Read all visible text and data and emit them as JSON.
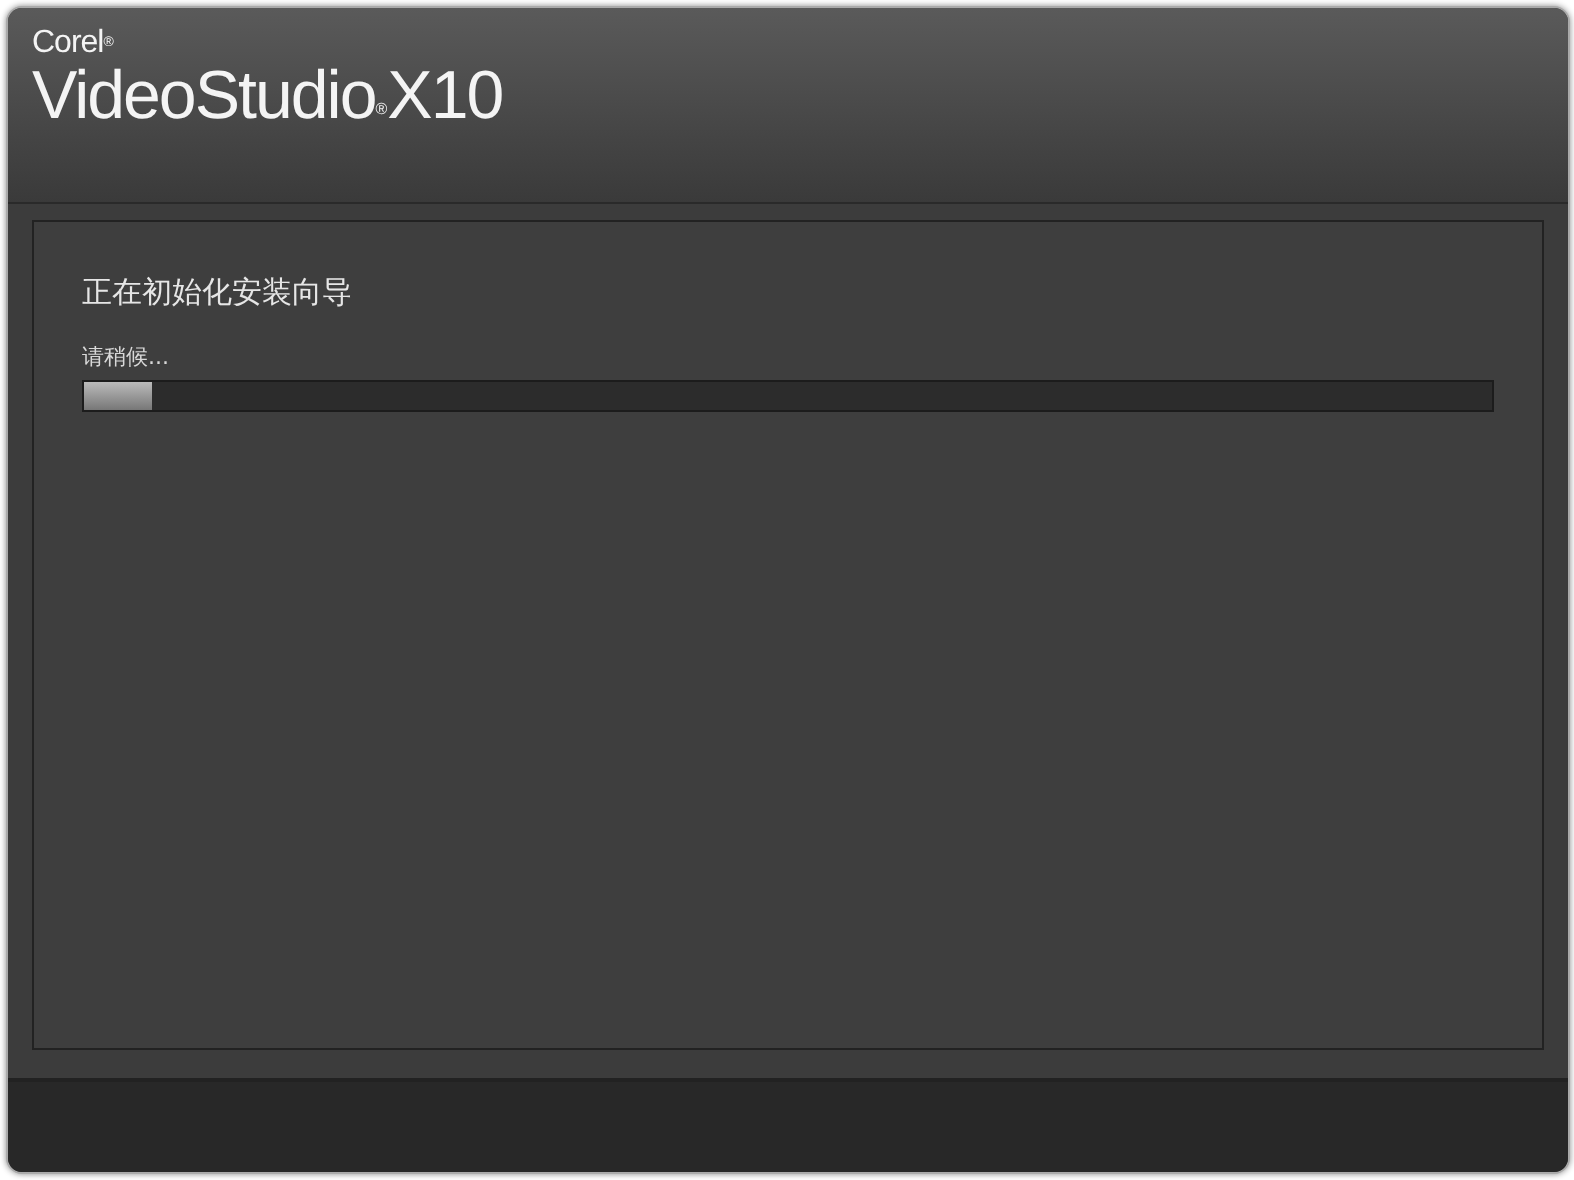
{
  "logo": {
    "brand": "Corel",
    "brand_mark": "®",
    "product": "VideoStudio",
    "product_mark": "®",
    "version": "X10"
  },
  "panel": {
    "heading": "正在初始化安装向导",
    "status": "请稍候...",
    "progress": {
      "level": 0.048
    }
  }
}
